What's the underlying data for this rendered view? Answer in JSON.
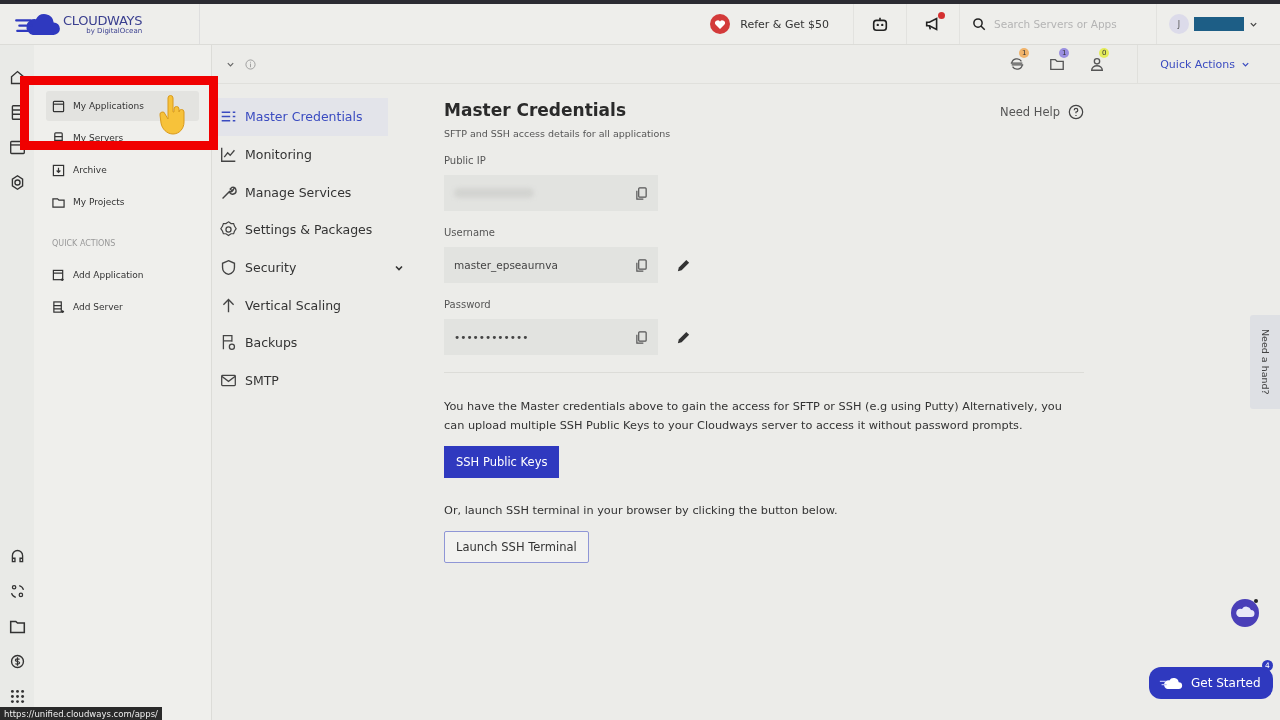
{
  "header": {
    "brand": "CLOUDWAYS",
    "brand_sub": "by DigitalOcean",
    "refer": "Refer & Get $50",
    "search": {
      "placeholder": "Search Servers or Apps"
    },
    "avatar": "J",
    "notification_dot": true
  },
  "flyout": {
    "items": [
      {
        "label": "My Applications",
        "hovered": true
      },
      {
        "label": "My Servers",
        "hovered": false
      },
      {
        "label": "Archive",
        "hovered": false
      },
      {
        "label": "My Projects",
        "hovered": false
      }
    ],
    "section": "QUICK ACTIONS",
    "actions": [
      {
        "label": "Add Application"
      },
      {
        "label": "Add Server"
      }
    ]
  },
  "highlight_box": true,
  "toolbar": {
    "badges": [
      {
        "count": "1",
        "color": "#f0b36a"
      },
      {
        "count": "1",
        "color": "#9a8fe0"
      },
      {
        "count": "0",
        "color": "#e4ec5a"
      }
    ],
    "quick_actions": "Quick Actions"
  },
  "menu": [
    {
      "label": "Master Credentials",
      "selected": true,
      "expandable": false
    },
    {
      "label": "Monitoring",
      "selected": false,
      "expandable": false
    },
    {
      "label": "Manage Services",
      "selected": false,
      "expandable": false
    },
    {
      "label": "Settings & Packages",
      "selected": false,
      "expandable": false
    },
    {
      "label": "Security",
      "selected": false,
      "expandable": true
    },
    {
      "label": "Vertical Scaling",
      "selected": false,
      "expandable": false
    },
    {
      "label": "Backups",
      "selected": false,
      "expandable": false
    },
    {
      "label": "SMTP",
      "selected": false,
      "expandable": false
    }
  ],
  "main": {
    "title": "Master Credentials",
    "subtitle": "SFTP and SSH access details for all applications",
    "help": "Need Help",
    "fields": [
      {
        "label": "Public IP",
        "editable": false
      },
      {
        "label": "Username",
        "value": "master_epseaurnva",
        "editable": true
      },
      {
        "label": "Password",
        "value": "••••••••••••",
        "editable": true
      }
    ],
    "note": "You have the Master credentials above to gain the access for SFTP or SSH (e.g using Putty) Alternatively, you can upload multiple SSH Public Keys to your Cloudways server to access it without password prompts.",
    "keys_button": "SSH Public Keys",
    "note2": "Or, launch SSH terminal in your browser by clicking the button below.",
    "terminal_button": "Launch SSH Terminal"
  },
  "side_tab": "Need a hand?",
  "get_started": {
    "label": "Get Started",
    "count": "4"
  },
  "status_url": "https://unified.cloudways.com/apps/"
}
